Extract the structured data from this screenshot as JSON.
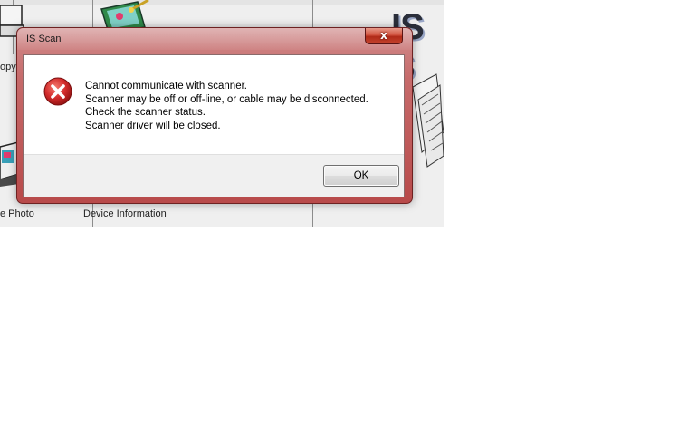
{
  "background_app": {
    "labels": {
      "copy_fragment": "opy",
      "photo_fragment": "e Photo",
      "device_information": "Device Information"
    },
    "brand_fragment": "IS S",
    "icons": [
      "scanner-copy-icon",
      "paint-image-icon",
      "photo-scanner-icon",
      "scanned-documents-image"
    ]
  },
  "dialog": {
    "title": "IS Scan",
    "close_label": "x",
    "icon": "error-icon",
    "message_lines": [
      "Cannot communicate with scanner.",
      "Scanner may be off or off-line, or cable may be disconnected.",
      "Check the scanner status.",
      "Scanner driver will be closed."
    ],
    "ok_label": "OK"
  },
  "colors": {
    "title_bar": "#c66a6a",
    "error_icon": "#d22b2b"
  }
}
